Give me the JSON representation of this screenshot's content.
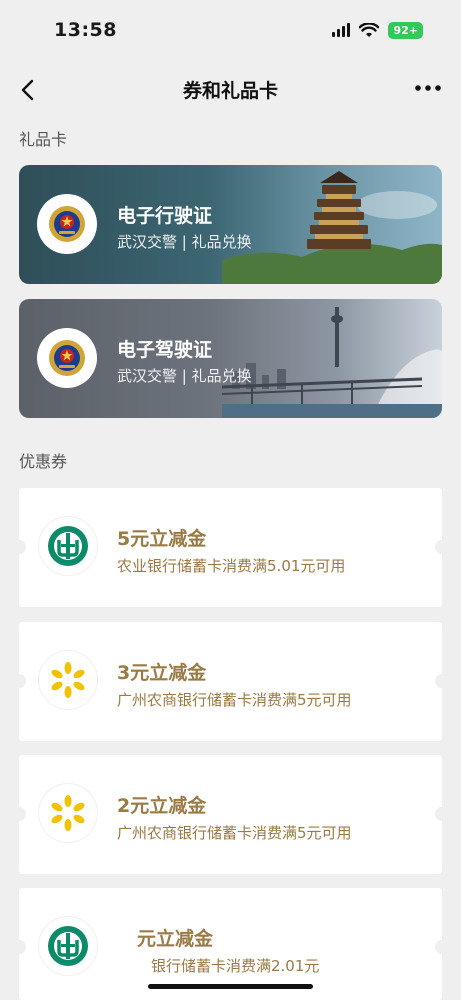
{
  "status_bar": {
    "time": "13:58",
    "battery": "92+"
  },
  "nav": {
    "title": "券和礼品卡"
  },
  "sections": {
    "gift_cards": "礼品卡",
    "coupons": "优惠券"
  },
  "gift_cards": [
    {
      "title": "电子行驶证",
      "subtitle": "武汉交警 | 礼品兑换"
    },
    {
      "title": "电子驾驶证",
      "subtitle": "武汉交警 | 礼品兑换"
    }
  ],
  "coupons": [
    {
      "title": "5元立减金",
      "desc": "农业银行储蓄卡消费满5.01元可用",
      "logo": "abc-bank-icon"
    },
    {
      "title": "3元立减金",
      "desc": "广州农商银行储蓄卡消费满5元可用",
      "logo": "grcb-bank-icon"
    },
    {
      "title": "2元立减金",
      "desc": "广州农商银行储蓄卡消费满5元可用",
      "logo": "grcb-bank-icon"
    },
    {
      "title": "元立减金",
      "desc": "银行储蓄卡消费满2.01元",
      "logo": "abc-bank-icon"
    }
  ],
  "colors": {
    "coupon_text": "#9a7a45",
    "background": "#efefef"
  }
}
